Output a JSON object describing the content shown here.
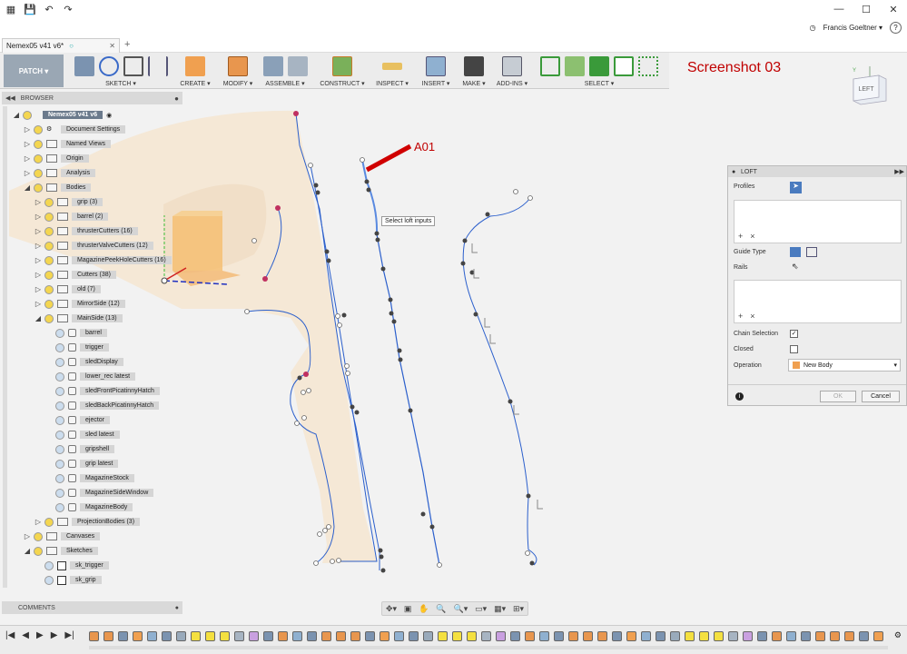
{
  "titlebar": {
    "qat_icons": [
      "grid-icon",
      "save-icon",
      "undo-icon",
      "redo-icon"
    ]
  },
  "document": {
    "tab_title": "Nemex05 v41 v6*"
  },
  "user": {
    "name": "Francis Goeltner ▾",
    "help": "?"
  },
  "ribbon": {
    "workspace": "PATCH ▾",
    "groups": [
      "SKETCH ▾",
      "CREATE ▾",
      "MODIFY ▾",
      "ASSEMBLE ▾",
      "CONSTRUCT ▾",
      "INSPECT ▾",
      "INSERT ▾",
      "MAKE ▾",
      "ADD-INS ▾",
      "SELECT ▾"
    ]
  },
  "watermark": "Screenshot 03",
  "viewcube": {
    "face": "LEFT",
    "axis": "Y"
  },
  "browser": {
    "header": "BROWSER",
    "items": [
      {
        "label": "Nemex05 v41 v6",
        "tog": "◢"
      },
      {
        "label": "Document Settings",
        "tog": "▷"
      },
      {
        "label": "Named Views",
        "tog": "▷"
      },
      {
        "label": "Origin",
        "tog": "▷"
      },
      {
        "label": "Analysis",
        "tog": "▷"
      },
      {
        "label": "Bodies",
        "tog": "◢"
      },
      {
        "label": "grip (3)",
        "tog": "▷"
      },
      {
        "label": "barrel (2)",
        "tog": "▷"
      },
      {
        "label": "thrusterCutters (16)",
        "tog": "▷"
      },
      {
        "label": "thrusterValveCutters (12)",
        "tog": "▷"
      },
      {
        "label": "MagazinePeekHoleCutters (16)",
        "tog": "▷"
      },
      {
        "label": "Cutters (38)",
        "tog": "▷"
      },
      {
        "label": "old (7)",
        "tog": "▷"
      },
      {
        "label": "MirrorSide (12)",
        "tog": "▷"
      },
      {
        "label": "MainSide (13)",
        "tog": "◢"
      },
      {
        "label": "barrel",
        "tog": ""
      },
      {
        "label": "trigger",
        "tog": ""
      },
      {
        "label": "sledDisplay",
        "tog": ""
      },
      {
        "label": "lower_rec latest",
        "tog": ""
      },
      {
        "label": "sledFrontPicatinnyHatch",
        "tog": ""
      },
      {
        "label": "sledBackPicatinnyHatch",
        "tog": ""
      },
      {
        "label": "ejector",
        "tog": ""
      },
      {
        "label": "sled latest",
        "tog": ""
      },
      {
        "label": "gripshell",
        "tog": ""
      },
      {
        "label": "grip latest",
        "tog": ""
      },
      {
        "label": "MagazineStock",
        "tog": ""
      },
      {
        "label": "MagazineSideWindow",
        "tog": ""
      },
      {
        "label": "MagazineBody",
        "tog": ""
      },
      {
        "label": "ProjectionBodies (3)",
        "tog": "▷"
      },
      {
        "label": "Canvases",
        "tog": "▷"
      },
      {
        "label": "Sketches",
        "tog": "◢"
      },
      {
        "label": "sk_trigger",
        "tog": ""
      },
      {
        "label": "sk_grip",
        "tog": ""
      }
    ]
  },
  "comments": {
    "label": "COMMENTS"
  },
  "tooltip": "Select loft inputs",
  "annotation": "A01",
  "loft": {
    "title": "LOFT",
    "profiles_label": "Profiles",
    "guide_type_label": "Guide Type",
    "rails_label": "Rails",
    "chain_selection_label": "Chain Selection",
    "chain_selection_checked": true,
    "closed_label": "Closed",
    "closed_checked": false,
    "operation_label": "Operation",
    "operation_value": "New Body",
    "ok_label": "OK",
    "cancel_label": "Cancel",
    "add_symbol": "+",
    "remove_symbol": "×"
  },
  "timeline": {
    "controls": [
      "|◀",
      "◀",
      "▶",
      "▶",
      "▶|"
    ]
  },
  "colors": {
    "accent_red": "#c00000",
    "sketch_blue": "#2b5fcc",
    "body_tan": "#f5e4cc",
    "workspace_blue": "#9aa7b4"
  }
}
